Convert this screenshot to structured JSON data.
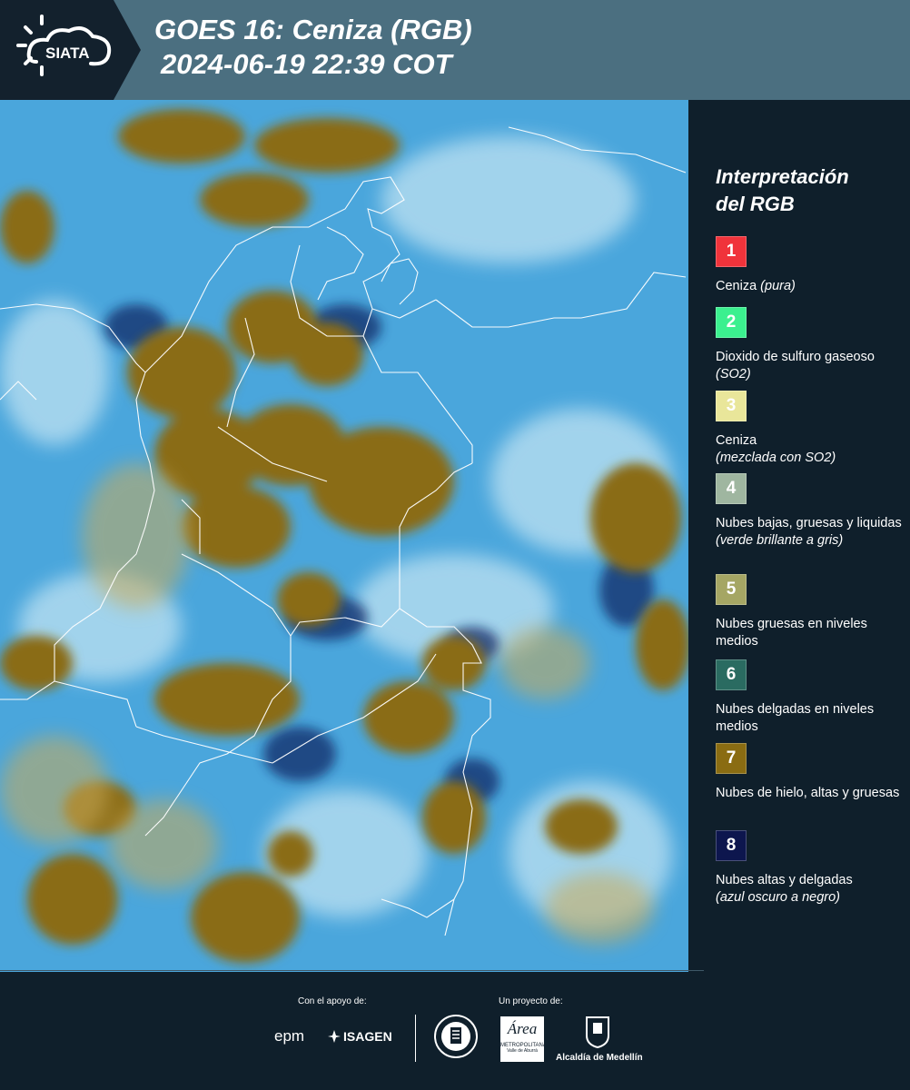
{
  "header": {
    "logo_text": "SIATA",
    "title_line1": "GOES 16: Ceniza (RGB)",
    "title_line2": "2024-06-19 22:39 COT"
  },
  "legend": {
    "title_line1": "Interpretación",
    "title_line2": "del RGB",
    "items": [
      {
        "number": "1",
        "color": "#f0333b",
        "label": "Ceniza",
        "note": "(pura)"
      },
      {
        "number": "2",
        "color": "#3bf08f",
        "label": "Dioxido de sulfuro gaseoso",
        "note": "(SO2)"
      },
      {
        "number": "3",
        "color": "#e9e69a",
        "label": "Ceniza",
        "note": "(mezclada con SO2)"
      },
      {
        "number": "4",
        "color": "#9fb6a0",
        "label": "Nubes bajas, gruesas y liquidas",
        "note": "(verde brillante a gris)"
      },
      {
        "number": "5",
        "color": "#a5a664",
        "label": "Nubes gruesas en niveles medios",
        "note": ""
      },
      {
        "number": "6",
        "color": "#2a6b61",
        "label": "Nubes delgadas en niveles medios",
        "note": ""
      },
      {
        "number": "7",
        "color": "#8a6c12",
        "label": "Nubes de hielo, altas y gruesas",
        "note": ""
      },
      {
        "number": "8",
        "color": "#0d164e",
        "label": "Nubes altas y delgadas",
        "note": "(azul oscuro a negro)"
      }
    ]
  },
  "footer": {
    "support_caption": "Con el apoyo de:",
    "project_caption": "Un proyecto de:",
    "epm": "epm",
    "isagen": "ISAGEN",
    "area_name": "Área",
    "area_sub": "METROPOLITANA",
    "area_sub2": "Valle de Aburrá",
    "alcaldia": "Alcaldía de Medellín"
  },
  "colors": {
    "header_bg": "#4b6f80",
    "page_bg": "#0f1f2b",
    "ice_cloud": "#8a6c12",
    "clear_sky": "#4aa6dc"
  }
}
